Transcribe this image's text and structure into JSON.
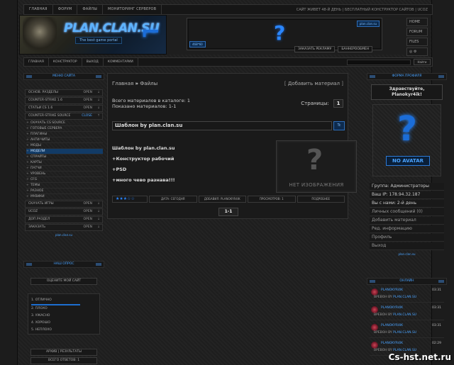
{
  "topnav": {
    "items": [
      "Главная",
      "Форум",
      "Файлы",
      "Мониторинг серверов"
    ],
    "right": "Сайт живет 48-й день | Бесплатный конструктор сайтов | uCoz"
  },
  "banner": {
    "brand": "PLAN.CLAN.SU",
    "sub": "The best game portal"
  },
  "ad": {
    "label": "plan.clan.su",
    "label2": "468*60",
    "btn1": "Заказать рекламу",
    "btn2": "Баннерообмен"
  },
  "sidebtns": [
    "Home",
    "Forum",
    "Files"
  ],
  "subnav": {
    "items": [
      "Главная",
      "Конструктор",
      "Выход",
      "Комментарии"
    ],
    "search_btn": "Найти"
  },
  "left": {
    "title": "Меню сайта",
    "items": [
      {
        "label": "Основ. разделы",
        "state": "Open",
        "type": "menu"
      },
      {
        "label": "Counter-Strike 1.6",
        "state": "Open",
        "type": "menu"
      },
      {
        "label": "Статьи CS 1.6",
        "state": "Open",
        "type": "menu"
      },
      {
        "label": "Counter-Strike Source",
        "state": "Close",
        "type": "menu"
      }
    ],
    "subs": [
      "Скачать CS Source",
      "Готовые сервера",
      "Плагины",
      "Анти-читы",
      "Моды",
      "Модели",
      "Спрайты",
      "Карты",
      "Патчи",
      "Уровень",
      "CFG",
      "Темы",
      "Разное",
      "Мувики"
    ],
    "items2": [
      {
        "label": "Скачать игры",
        "state": "Open"
      },
      {
        "label": "uCoz",
        "state": "Open"
      },
      {
        "label": "Доп.Раздел",
        "state": "Open"
      },
      {
        "label": "Заказать",
        "state": "Open"
      }
    ],
    "foot": "plan.clan.su"
  },
  "poll": {
    "title": "Наш опрос",
    "btn": "Оцените мой сайт",
    "options": [
      "1. Отлично",
      "2. Плохо",
      "3. Ужасно",
      "4. Хорошо",
      "5. Неплохо"
    ],
    "results": "Архив | Результаты",
    "total": "Всего ответов: 1"
  },
  "main": {
    "crumb_home": "Главная",
    "crumb_sep": "»",
    "crumb_current": "Файлы",
    "add": "Добавить материал",
    "count_total": "Всего материалов в каталоге: 1",
    "count_shown": "Показано материалов: 1-1",
    "pages_label": "Страницы:",
    "page": "1",
    "entry_title": "Шаблон by plan.clan.su",
    "entry_icon": "Tc",
    "lines": [
      "Шаблон by plan.clan.su",
      "+Конструктор рабочий",
      "+PSD",
      "+много чево разнава!!!"
    ],
    "noimg": "Нет изображения",
    "foot": [
      "Дата: Сегодня",
      "Добавил: Planokyr4ik",
      "Просмотров: 1",
      "Подробнее"
    ],
    "pager": "1-1"
  },
  "right": {
    "title": "Форма профиля",
    "hello1": "Здравствуйте,",
    "hello2": "Planokyr4ik!",
    "noavatar": "No avatar",
    "rows": [
      "Группа: Администраторы",
      "Ваш IP: 178.94.32.187",
      "Вы с нами: 2-й день"
    ],
    "links": [
      "Личных сообщений (0)",
      "Добавить материал",
      "Ред. информацию",
      "Профиль",
      "Выход"
    ],
    "foot": "plan.clan.su"
  },
  "online": {
    "title": "Онлайн",
    "users": [
      {
        "name": "Planokyr4ik",
        "time": "03:31",
        "sub1": "Вревон by",
        "sub2": "plan.clan.su"
      },
      {
        "name": "Planokyr4ik",
        "time": "03:31",
        "sub1": "Вревон by",
        "sub2": "plan.clan.su"
      },
      {
        "name": "Planokyr4ik",
        "time": "03:31",
        "sub1": "Вревон by",
        "sub2": "plan.clan.su"
      },
      {
        "name": "Planokyr4ik",
        "time": "02:29",
        "sub1": "Вревон by",
        "sub2": "plan.clan.su"
      }
    ]
  },
  "watermark": "Cs-hst.net.ru"
}
